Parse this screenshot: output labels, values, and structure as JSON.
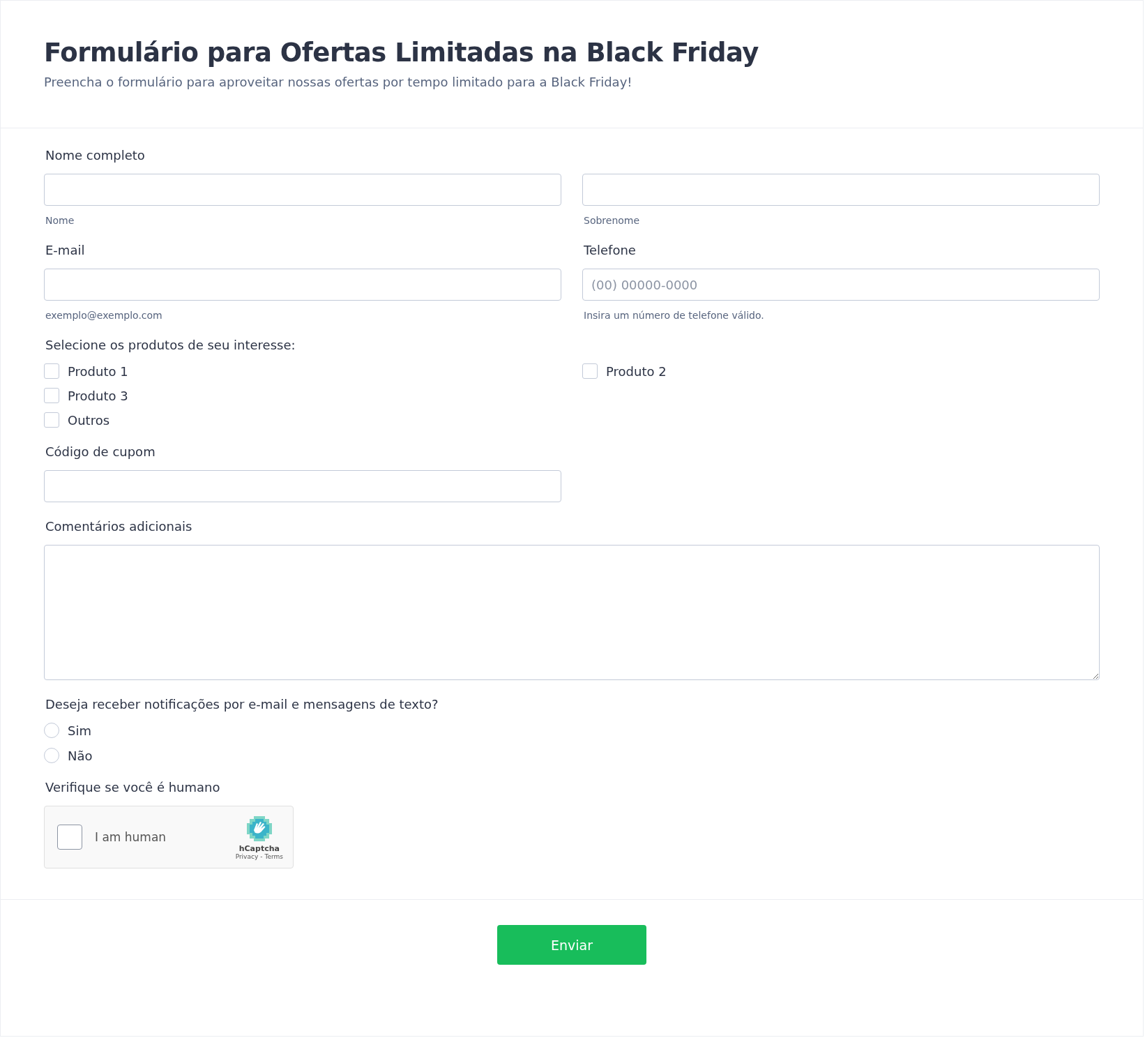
{
  "header": {
    "title": "Formulário para Ofertas Limitadas na Black Friday",
    "subtitle": "Preencha o formulário para aproveitar nossas ofertas por tempo limitado para a Black Friday!"
  },
  "full_name": {
    "label": "Nome completo",
    "fields": [
      {
        "sublabel": "Nome"
      },
      {
        "sublabel": "Sobrenome"
      }
    ]
  },
  "contact": [
    {
      "label": "E-mail",
      "sublabel": "exemplo@exemplo.com"
    },
    {
      "label": "Telefone",
      "placeholder": "(00) 00000-0000",
      "sublabel": "Insira um número de telefone válido."
    }
  ],
  "products": {
    "label": "Selecione os produtos de seu interesse:",
    "options": [
      {
        "label": "Produto 1",
        "kind": "option",
        "checked": false
      },
      {
        "label": "Produto 2",
        "kind": "option",
        "checked": false
      },
      {
        "label": "Produto 3",
        "kind": "option",
        "checked": false
      },
      {
        "label": "Outros",
        "kind": "other",
        "checked": false
      }
    ]
  },
  "coupon": {
    "label": "Código de cupom"
  },
  "comments": {
    "label": "Comentários adicionais"
  },
  "notifications": {
    "label": "Deseja receber notificações por e-mail e mensagens de texto?",
    "options": [
      {
        "label": "Sim",
        "selected": false
      },
      {
        "label": "Não",
        "selected": false
      }
    ]
  },
  "captcha": {
    "label": "Verifique se você é humano",
    "checkbox_label": "I am human",
    "checked": false,
    "brand": "hCaptcha",
    "privacy": "Privacy",
    "separator": "-",
    "terms": "Terms"
  },
  "submit": {
    "label": "Enviar"
  }
}
